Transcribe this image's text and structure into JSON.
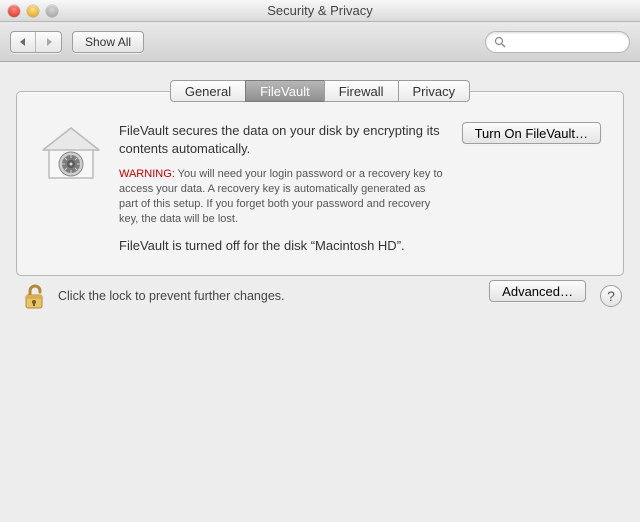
{
  "window": {
    "title": "Security & Privacy"
  },
  "toolbar": {
    "show_all": "Show All",
    "search_placeholder": ""
  },
  "tabs": {
    "general": "General",
    "filevault": "FileVault",
    "firewall": "Firewall",
    "privacy": "Privacy",
    "selected": "filevault"
  },
  "filevault": {
    "headline": "FileVault secures the data on your disk by encrypting its contents automatically.",
    "warning_label": "WARNING:",
    "warning_body": " You will need your login password or a recovery key to access your data. A recovery key is automatically generated as part of this setup. If you forget both your password and recovery key, the data will be lost.",
    "status": "FileVault is turned off for the disk “Macintosh HD”.",
    "turn_on_label": "Turn On FileVault…"
  },
  "footer": {
    "lock_text": "Click the lock to prevent further changes.",
    "advanced_label": "Advanced…",
    "help_label": "?"
  }
}
